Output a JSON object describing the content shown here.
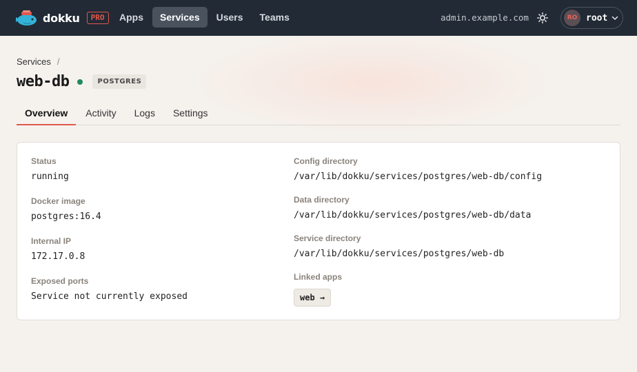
{
  "nav": {
    "brand": "dokku",
    "badge": "PRO",
    "links": [
      {
        "label": "Apps"
      },
      {
        "label": "Services",
        "active": true
      },
      {
        "label": "Users"
      },
      {
        "label": "Teams"
      }
    ],
    "hostname": "admin.example.com",
    "user": {
      "initials": "RO",
      "name": "root"
    }
  },
  "breadcrumb": {
    "items": [
      "Services"
    ],
    "separator": "/"
  },
  "service": {
    "name": "web-db",
    "status_color": "#1f8a5b",
    "type": "POSTGRES"
  },
  "tabs": [
    {
      "label": "Overview",
      "active": true
    },
    {
      "label": "Activity"
    },
    {
      "label": "Logs"
    },
    {
      "label": "Settings"
    }
  ],
  "details": {
    "left": [
      {
        "label": "Status",
        "value": "running"
      },
      {
        "label": "Docker image",
        "value": "postgres:16.4"
      },
      {
        "label": "Internal IP",
        "value": "172.17.0.8"
      },
      {
        "label": "Exposed ports",
        "value": "Service not currently exposed"
      }
    ],
    "right": [
      {
        "label": "Config directory",
        "value": "/var/lib/dokku/services/postgres/web-db/config"
      },
      {
        "label": "Data directory",
        "value": "/var/lib/dokku/services/postgres/web-db/data"
      },
      {
        "label": "Service directory",
        "value": "/var/lib/dokku/services/postgres/web-db"
      }
    ],
    "linked_apps": {
      "label": "Linked apps",
      "apps": [
        "web →"
      ]
    }
  },
  "colors": {
    "nav_bg": "#222a35",
    "accent": "#e0584c",
    "page_bg": "#f5f2ee"
  },
  "icons": {
    "theme": "sun-icon",
    "user_menu": "chevron-down-icon",
    "brand": "dokku-whale-logo"
  }
}
